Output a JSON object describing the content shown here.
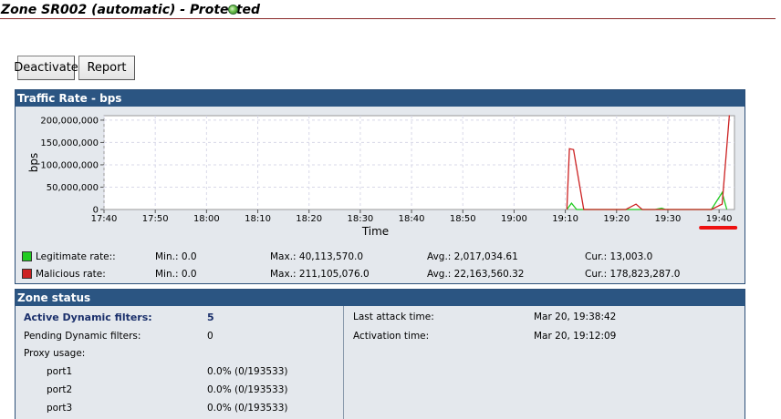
{
  "header": {
    "title": "Zone SR002 (automatic) - Protected",
    "status_icon": "status-green-dot-icon",
    "status_color": "#4caf3a"
  },
  "toolbar": {
    "deactivate_label": "Deactivate",
    "report_label": "Report"
  },
  "traffic_panel": {
    "title": "Traffic Rate - bps",
    "legend": [
      {
        "label": "Legitimate rate::",
        "color": "#22cc22",
        "min": "Min.: 0.0",
        "max": "Max.: 40,113,570.0",
        "avg": "Avg.: 2,017,034.61",
        "cur": "Cur.: 13,003.0"
      },
      {
        "label": "Malicious rate:",
        "color": "#cc2222",
        "min": "Min.: 0.0",
        "max": "Max.: 211,105,076.0",
        "avg": "Avg.: 22,163,560.32",
        "cur": "Cur.: 178,823,287.0"
      }
    ]
  },
  "chart_data": {
    "type": "line",
    "xlabel": "Time",
    "ylabel": "bps",
    "x_ticks": [
      "17:40",
      "17:50",
      "18:00",
      "18:10",
      "18:20",
      "18:30",
      "18:40",
      "18:50",
      "19:00",
      "19:10",
      "19:20",
      "19:30",
      "19:40"
    ],
    "y_ticks": [
      "0",
      "50,000,000",
      "100,000,000",
      "150,000,000",
      "200,000,000"
    ],
    "xlim_minutes": [
      1060,
      1183
    ],
    "ylim": [
      0,
      210000000
    ],
    "highlighted_tick": "19:40",
    "highlight_color": "#ee1111",
    "grid": true,
    "series": [
      {
        "name": "Legitimate rate",
        "color": "#22cc22",
        "points": [
          [
            1150.3,
            0
          ],
          [
            1151.2,
            14000000
          ],
          [
            1152.2,
            0
          ],
          [
            1167.5,
            0
          ],
          [
            1168.8,
            3000000
          ],
          [
            1169.5,
            0
          ],
          [
            1178.5,
            0
          ],
          [
            1180.6,
            38000000
          ],
          [
            1181.5,
            0
          ]
        ]
      },
      {
        "name": "Malicious rate",
        "color": "#cc2222",
        "points": [
          [
            1150.3,
            0
          ],
          [
            1150.8,
            136000000
          ],
          [
            1151.6,
            134000000
          ],
          [
            1153.6,
            0
          ],
          [
            1161.8,
            0
          ],
          [
            1163.8,
            12000000
          ],
          [
            1165.0,
            0
          ],
          [
            1178.5,
            0
          ],
          [
            1180.6,
            12000000
          ],
          [
            1182.0,
            211000000
          ]
        ]
      }
    ]
  },
  "zone_panel": {
    "title": "Zone status",
    "active_label": "Active Dynamic filters:",
    "active_value": "5",
    "pending_label": "Pending Dynamic filters:",
    "pending_value": "0",
    "proxy_label": "Proxy usage:",
    "ports": [
      {
        "name": "port1",
        "value": "0.0% (0/193533)"
      },
      {
        "name": "port2",
        "value": "0.0% (0/193533)"
      },
      {
        "name": "port3",
        "value": "0.0% (0/193533)"
      }
    ],
    "last_attack_label": "Last attack time:",
    "last_attack_value": "Mar 20, 19:38:42",
    "activation_label": "Activation time:",
    "activation_value": "Mar 20, 19:12:09"
  }
}
